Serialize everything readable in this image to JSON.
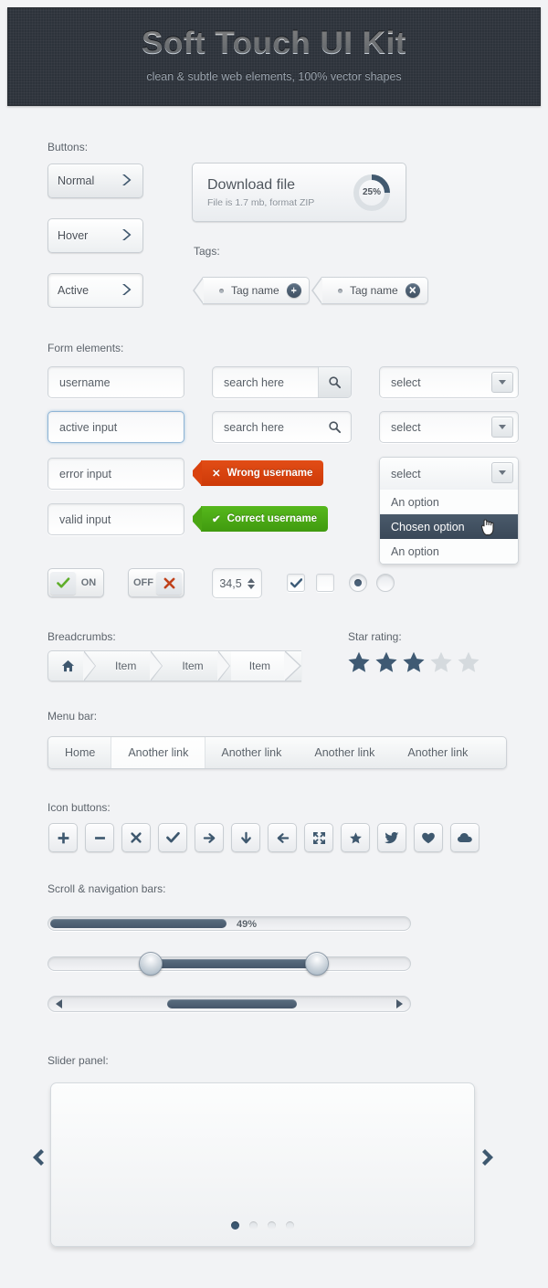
{
  "header": {
    "title": "Soft Touch UI Kit",
    "subtitle": "clean & subtle web elements, 100% vector shapes"
  },
  "sections": {
    "buttons": "Buttons:",
    "tags": "Tags:",
    "form": "Form elements:",
    "breadcrumbs": "Breadcrumbs:",
    "star_rating": "Star rating:",
    "menu_bar": "Menu bar:",
    "icon_buttons": "Icon buttons:",
    "scroll_nav": "Scroll & navigation bars:",
    "slider_panel": "Slider panel:"
  },
  "buttons": [
    {
      "label": "Normal",
      "state": "normal"
    },
    {
      "label": "Hover",
      "state": "hover"
    },
    {
      "label": "Active",
      "state": "active"
    }
  ],
  "download": {
    "title": "Download file",
    "subtitle": "File is 1.7 mb, format ZIP",
    "percent_label": "25%",
    "percent_value": 25
  },
  "tags": [
    {
      "label": "Tag name",
      "action": "add",
      "glyph": "+"
    },
    {
      "label": "Tag name",
      "action": "remove",
      "glyph": "✕"
    }
  ],
  "form": {
    "inputs": [
      {
        "value": "username",
        "state": "normal"
      },
      {
        "value": "active input",
        "state": "focus"
      },
      {
        "value": "error input",
        "state": "error"
      },
      {
        "value": "valid input",
        "state": "valid"
      }
    ],
    "searches": [
      {
        "value": "search here",
        "button_style": "raised"
      },
      {
        "value": "search here",
        "button_style": "flat"
      }
    ],
    "messages": {
      "error": "Wrong username",
      "valid": "Correct username",
      "error_color": "#d9420e",
      "valid_color": "#4ba614"
    },
    "selects": [
      {
        "value": "select"
      },
      {
        "value": "select"
      }
    ],
    "dropdown": {
      "value": "select",
      "options": [
        "An option",
        "Chosen option",
        "An option"
      ],
      "selected_index": 1
    },
    "toggles": [
      {
        "label": "ON",
        "state": "on"
      },
      {
        "label": "OFF",
        "state": "off"
      }
    ],
    "spinner": {
      "value": "34,5"
    },
    "checkboxes": [
      {
        "checked": true
      },
      {
        "checked": false
      }
    ],
    "radios": [
      {
        "checked": true
      },
      {
        "checked": false
      }
    ]
  },
  "breadcrumbs": {
    "home_icon": "home-icon",
    "items": [
      "Item",
      "Item",
      "Item"
    ]
  },
  "stars": {
    "rating": 3,
    "total": 5
  },
  "menu": {
    "items": [
      "Home",
      "Another link",
      "Another link",
      "Another link",
      "Another link"
    ],
    "active_index": 1
  },
  "icon_buttons": [
    "plus-icon",
    "minus-icon",
    "close-icon",
    "check-icon",
    "arrow-right-icon",
    "arrow-down-icon",
    "arrow-left-icon",
    "expand-icon",
    "star-icon",
    "twitter-icon",
    "heart-icon",
    "cloud-icon"
  ],
  "bars": {
    "progress": {
      "percent": 49,
      "label": "49%"
    },
    "range": {
      "low": 28,
      "high": 74
    },
    "scrollbar": {
      "thumb_start": 33,
      "thumb_width": 36
    }
  },
  "slider": {
    "dots": 4,
    "active_dot": 0,
    "prev_icon": "chevron-left-icon",
    "next_icon": "chevron-right-icon"
  },
  "colors": {
    "accent": "#46576a",
    "header_bg": "#2d333b",
    "page_bg": "#f2f3f5"
  }
}
